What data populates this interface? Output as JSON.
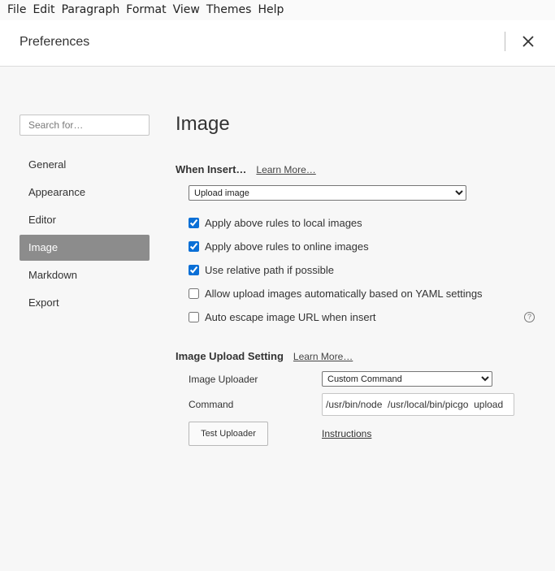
{
  "menubar": {
    "items": [
      "File",
      "Edit",
      "Paragraph",
      "Format",
      "View",
      "Themes",
      "Help"
    ]
  },
  "header": {
    "title": "Preferences",
    "close_icon": "close-icon"
  },
  "sidebar": {
    "search_placeholder": "Search for…",
    "items": [
      {
        "label": "General",
        "active": false
      },
      {
        "label": "Appearance",
        "active": false
      },
      {
        "label": "Editor",
        "active": false
      },
      {
        "label": "Image",
        "active": true
      },
      {
        "label": "Markdown",
        "active": false
      },
      {
        "label": "Export",
        "active": false
      }
    ]
  },
  "main": {
    "title": "Image",
    "when_insert": {
      "heading": "When Insert…",
      "link": "Learn More…",
      "selected": "Upload image",
      "options": [
        {
          "label": "Apply above rules to local images",
          "checked": true
        },
        {
          "label": "Apply above rules to online images",
          "checked": true
        },
        {
          "label": "Use relative path if possible",
          "checked": true
        },
        {
          "label": "Allow upload images automatically based on YAML settings",
          "checked": false
        },
        {
          "label": "Auto escape image URL when insert",
          "checked": false
        }
      ],
      "help_icon": "question-circle-icon"
    },
    "upload": {
      "heading": "Image Upload Setting",
      "link": "Learn More…",
      "uploader_label": "Image Uploader",
      "uploader_selected": "Custom Command",
      "command_label": "Command",
      "command_value": "/usr/bin/node  /usr/local/bin/picgo  upload",
      "test_button": "Test Uploader",
      "instructions_link": "Instructions"
    }
  },
  "colors": {
    "active_nav_bg": "#8c8c8c",
    "checkbox_accent": "#0a6fd6",
    "page_bg": "#f7f7f7"
  }
}
